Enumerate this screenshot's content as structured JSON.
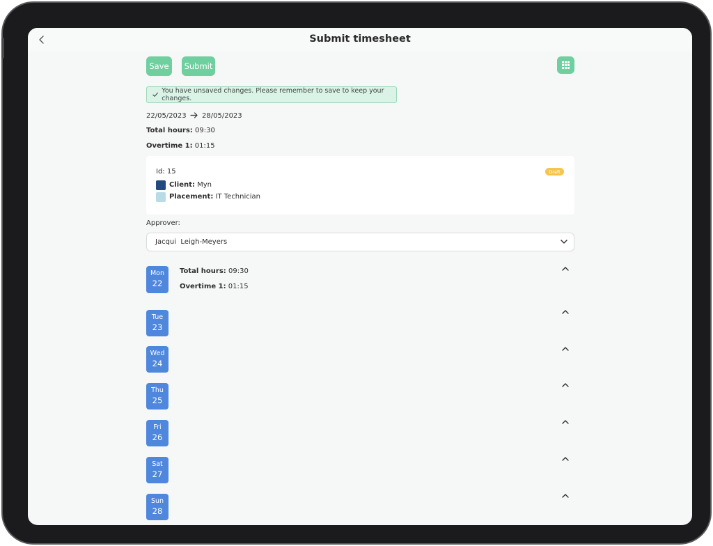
{
  "header": {
    "title": "Submit timesheet"
  },
  "toolbar": {
    "save_label": "Save",
    "submit_label": "Submit"
  },
  "alert": {
    "message": "You have unsaved changes. Please remember to save to keep your changes."
  },
  "period": {
    "start": "22/05/2023",
    "end": "28/05/2023"
  },
  "summary": {
    "total_label": "Total hours:",
    "total_value": "09:30",
    "overtime_label": "Overtime 1:",
    "overtime_value": "01:15"
  },
  "placement_card": {
    "id_text": "Id: 15",
    "status": "Draft",
    "client_label": "Client:",
    "client_value": "Myn",
    "placement_label": "Placement:",
    "placement_value": "IT Technician",
    "client_color": "#24497f",
    "placement_color": "#b9dbe6"
  },
  "approver": {
    "label": "Approver:",
    "value": "Jacqui  Leigh-Meyers"
  },
  "days": [
    {
      "name": "Mon",
      "date": "22",
      "total_label": "Total hours:",
      "total_value": "09:30",
      "overtime_label": "Overtime 1:",
      "overtime_value": "01:15"
    },
    {
      "name": "Tue",
      "date": "23"
    },
    {
      "name": "Wed",
      "date": "24"
    },
    {
      "name": "Thu",
      "date": "25"
    },
    {
      "name": "Fri",
      "date": "26"
    },
    {
      "name": "Sat",
      "date": "27"
    },
    {
      "name": "Sun",
      "date": "28"
    }
  ],
  "colors": {
    "accent_green": "#6fcf9f",
    "day_blue": "#4f87dd",
    "draft_yellow": "#f6c64c"
  }
}
